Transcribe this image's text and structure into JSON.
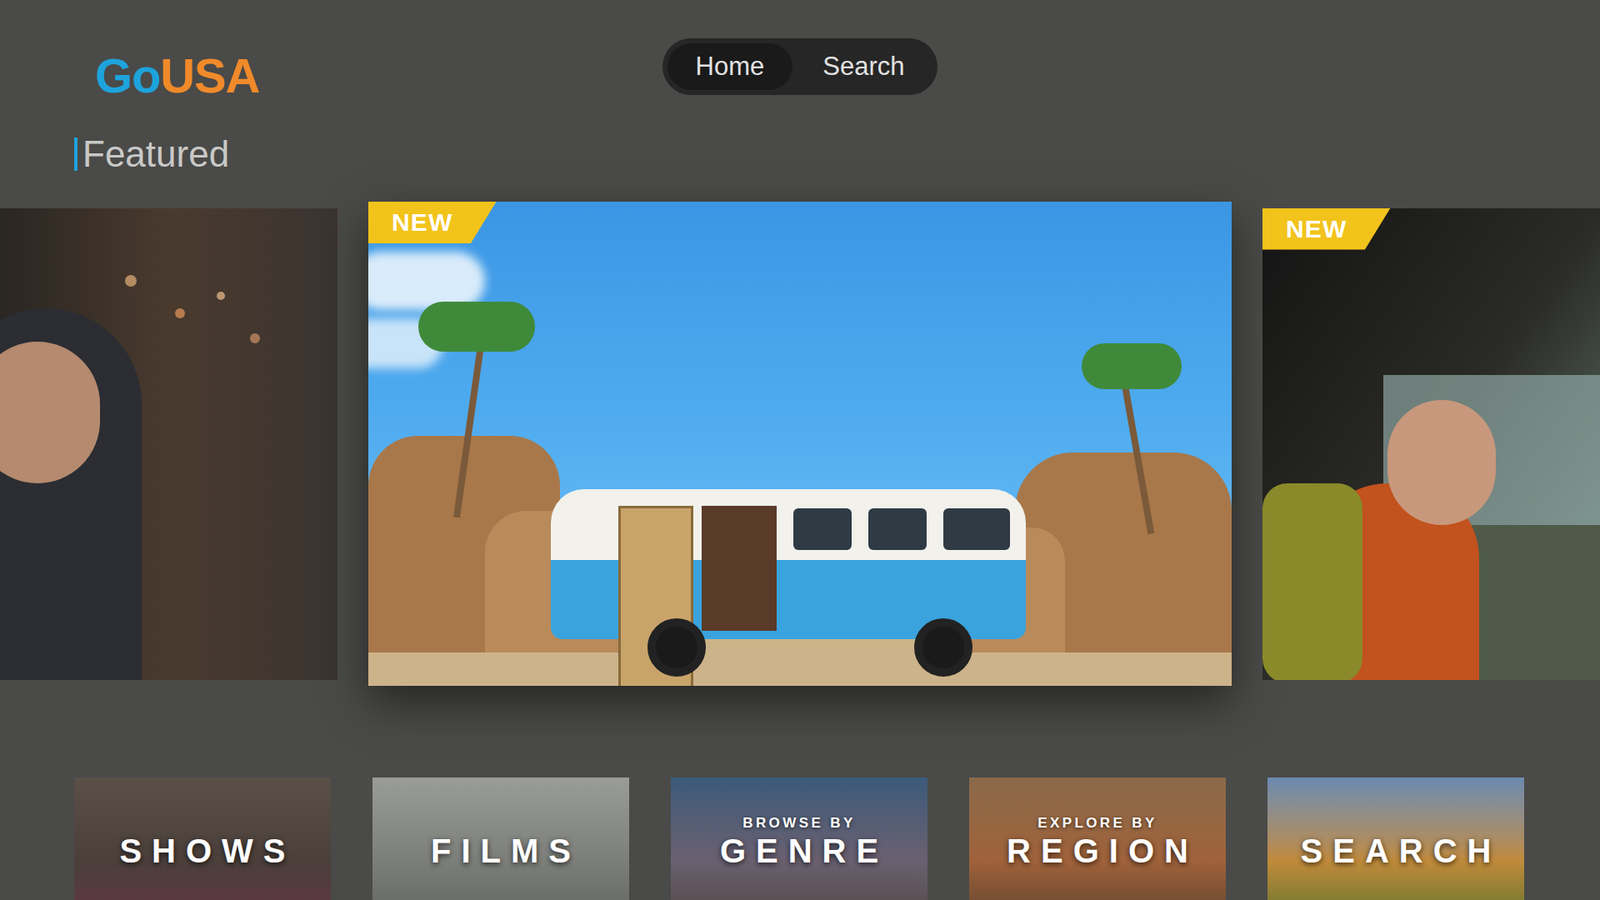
{
  "app": {
    "logo": [
      {
        "text": "Go",
        "color": "#1ea3dc"
      },
      {
        "text": "USA",
        "color": "#f08a2a"
      }
    ]
  },
  "nav": {
    "tabs": [
      {
        "label": "Home",
        "selected": true
      },
      {
        "label": "Search",
        "selected": false
      }
    ]
  },
  "section": {
    "title": "Featured"
  },
  "carousel": [
    {
      "selected": false
    },
    {
      "badge": "NEW",
      "selected": true
    },
    {
      "badge": "NEW",
      "selected": false
    }
  ],
  "categories": [
    {
      "label": "SHOWS"
    },
    {
      "label": "FILMS"
    },
    {
      "caption": "BROWSE BY",
      "label": "GENRE"
    },
    {
      "caption": "EXPLORE BY",
      "label": "REGION"
    },
    {
      "label": "SEARCH"
    }
  ]
}
